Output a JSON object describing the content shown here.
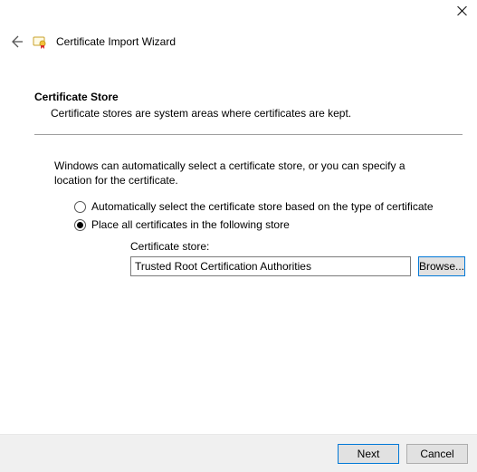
{
  "window": {
    "title": "Certificate Import Wizard"
  },
  "section": {
    "heading": "Certificate Store",
    "description": "Certificate stores are system areas where certificates are kept."
  },
  "body": {
    "intro": "Windows can automatically select a certificate store, or you can specify a location for the certificate.",
    "radio_auto": "Automatically select the certificate store based on the type of certificate",
    "radio_manual": "Place all certificates in the following store",
    "store_label": "Certificate store:",
    "store_value": "Trusted Root Certification Authorities",
    "browse": "Browse..."
  },
  "footer": {
    "next": "Next",
    "cancel": "Cancel"
  }
}
